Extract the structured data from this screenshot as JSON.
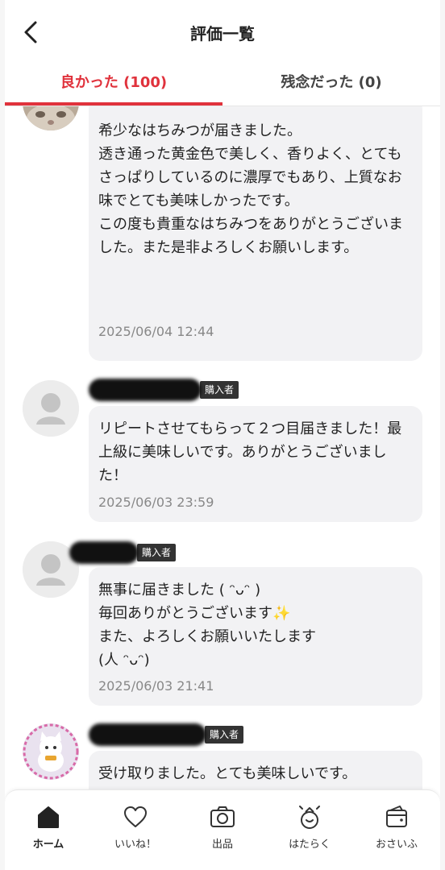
{
  "header": {
    "title": "評価一覧"
  },
  "tabs": [
    {
      "label": "良かった (100)",
      "active": true
    },
    {
      "label": "残念だった (0)",
      "active": false
    }
  ],
  "buyer_badge": "購入者",
  "reviews": [
    {
      "text": "希少なはちみつが届きました。\n透き通った黄金色で美しく、香りよく、とてもさっぱりしているのに濃厚でもあり、上質なお味でとても美味しかったです。\nこの度も貴重なはちみつをありがとうございました。また是非よろしくお願いします。",
      "date": "2025/06/04 12:44"
    },
    {
      "text": "リピートさせてもらって２つ目届きました！最上級に美味しいです。ありがとうございました！",
      "date": "2025/06/03 23:59"
    },
    {
      "text": "無事に届きました ( ᵔᴗᵔ )\n毎回ありがとうございます✨\nまた、よろしくお願いいたします\n(人 ᵔᴗᵔ)",
      "date": "2025/06/03 21:41"
    },
    {
      "text": "受け取りました。とても美味しいです。",
      "date": ""
    }
  ],
  "bottom_nav": [
    {
      "label": "ホーム",
      "icon": "home-icon",
      "active": true
    },
    {
      "label": "いいね！",
      "icon": "heart-icon",
      "active": false
    },
    {
      "label": "出品",
      "icon": "camera-icon",
      "active": false
    },
    {
      "label": "はたらく",
      "icon": "work-icon",
      "active": false
    },
    {
      "label": "おさいふ",
      "icon": "wallet-icon",
      "active": false
    }
  ],
  "colors": {
    "accent": "#e0323c",
    "bubble": "#f2f2f4"
  }
}
